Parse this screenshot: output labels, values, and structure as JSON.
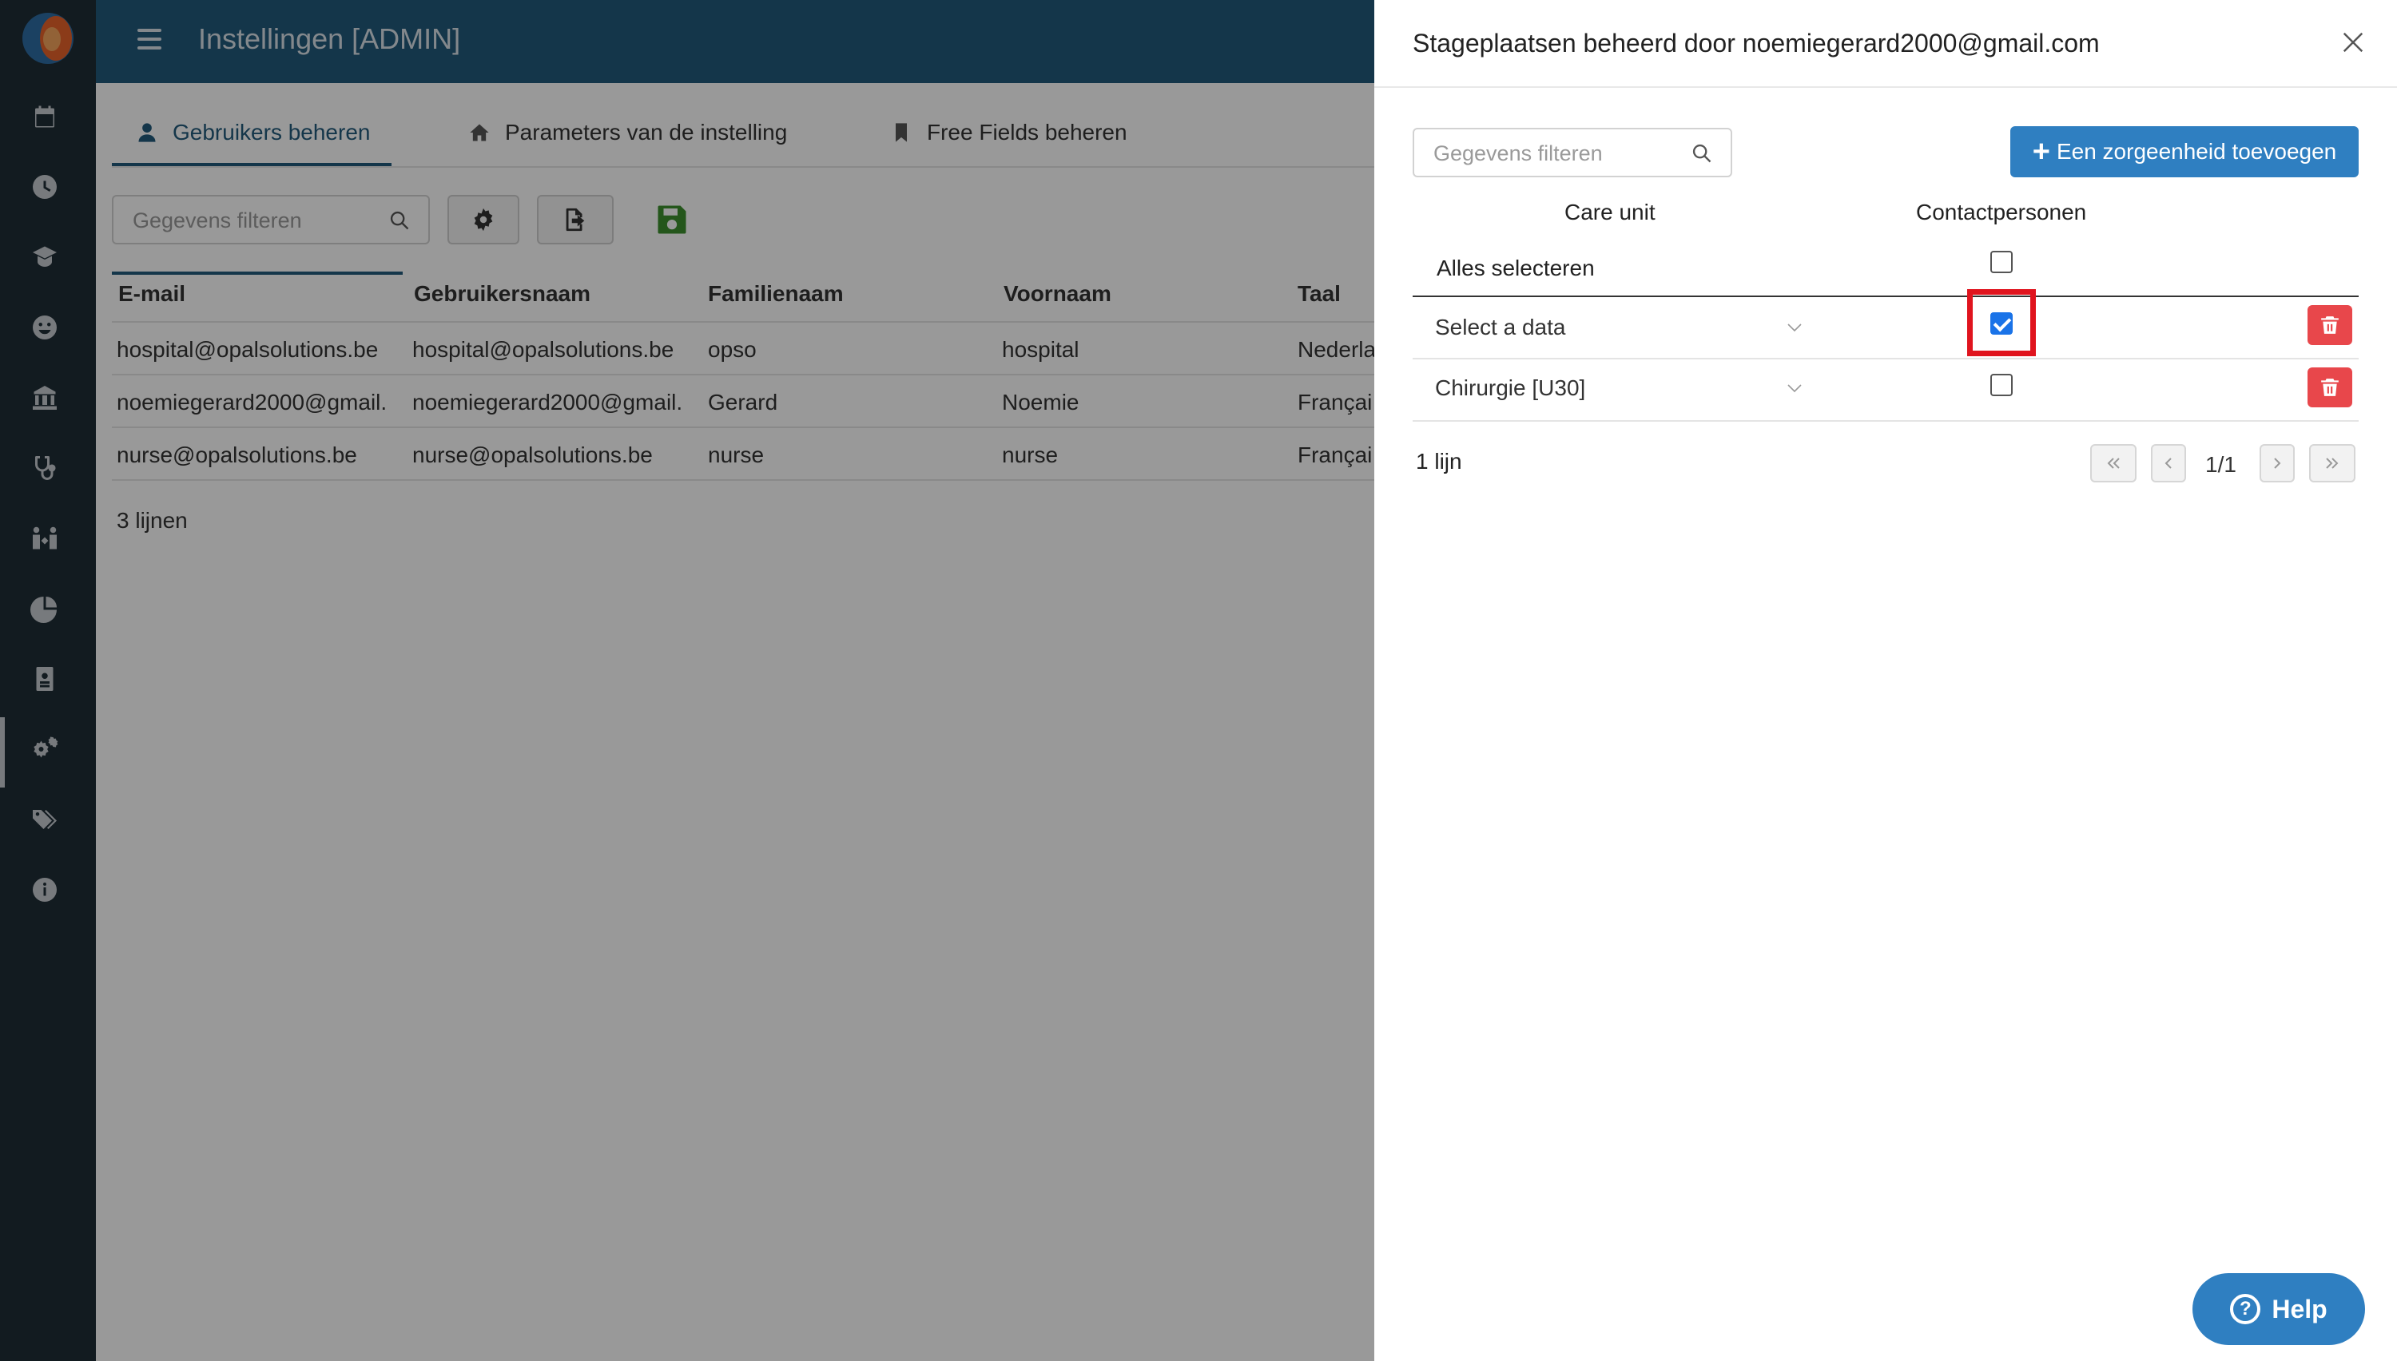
{
  "app": {
    "title": "Instellingen [ADMIN]",
    "sidebar_icons": [
      "calendar-icon",
      "clock-icon",
      "graduation-cap-icon",
      "smiley-icon",
      "institution-icon",
      "stethoscope-icon",
      "people-arrows-icon",
      "pie-chart-icon",
      "id-card-icon",
      "gears-icon",
      "tags-icon",
      "info-icon"
    ]
  },
  "tabs": [
    {
      "label": "Gebruikers beheren",
      "icon": "user-icon",
      "active": true
    },
    {
      "label": "Parameters van de instelling",
      "icon": "home-icon",
      "active": false
    },
    {
      "label": "Free Fields beheren",
      "icon": "bookmark-icon",
      "active": false
    }
  ],
  "toolbar": {
    "filter_placeholder": "Gegevens filteren"
  },
  "users_table": {
    "columns": [
      "E-mail",
      "Gebruikersnaam",
      "Familienaam",
      "Voornaam",
      "Taal"
    ],
    "rows": [
      [
        "hospital@opalsolutions.be",
        "hospital@opalsolutions.be",
        "opso",
        "hospital",
        "Nederla"
      ],
      [
        "noemiegerard2000@gmail.",
        "noemiegerard2000@gmail.",
        "Gerard",
        "Noemie",
        "Françai"
      ],
      [
        "nurse@opalsolutions.be",
        "nurse@opalsolutions.be",
        "nurse",
        "nurse",
        "Françai"
      ]
    ],
    "count": "3 lijnen"
  },
  "drawer": {
    "title": "Stageplaatsen beheerd door noemiegerard2000@gmail.com",
    "filter_placeholder": "Gegevens filteren",
    "add_button": "Een zorgeenheid toevoegen",
    "columns": {
      "care_unit": "Care unit",
      "contact": "Contactpersonen"
    },
    "select_all": "Alles selecteren",
    "rows": [
      {
        "care_unit": "Select a data",
        "checked": true
      },
      {
        "care_unit": "Chirurgie [U30]",
        "checked": false
      }
    ],
    "count": "1 lijn",
    "pagination": "1/1"
  },
  "help": {
    "label": "Help"
  },
  "colors": {
    "topbar": "#225b7c",
    "sidebar": "#1f2d36",
    "primary": "#2f7fc1",
    "danger": "#e8474b",
    "highlight": "#e0141e"
  }
}
